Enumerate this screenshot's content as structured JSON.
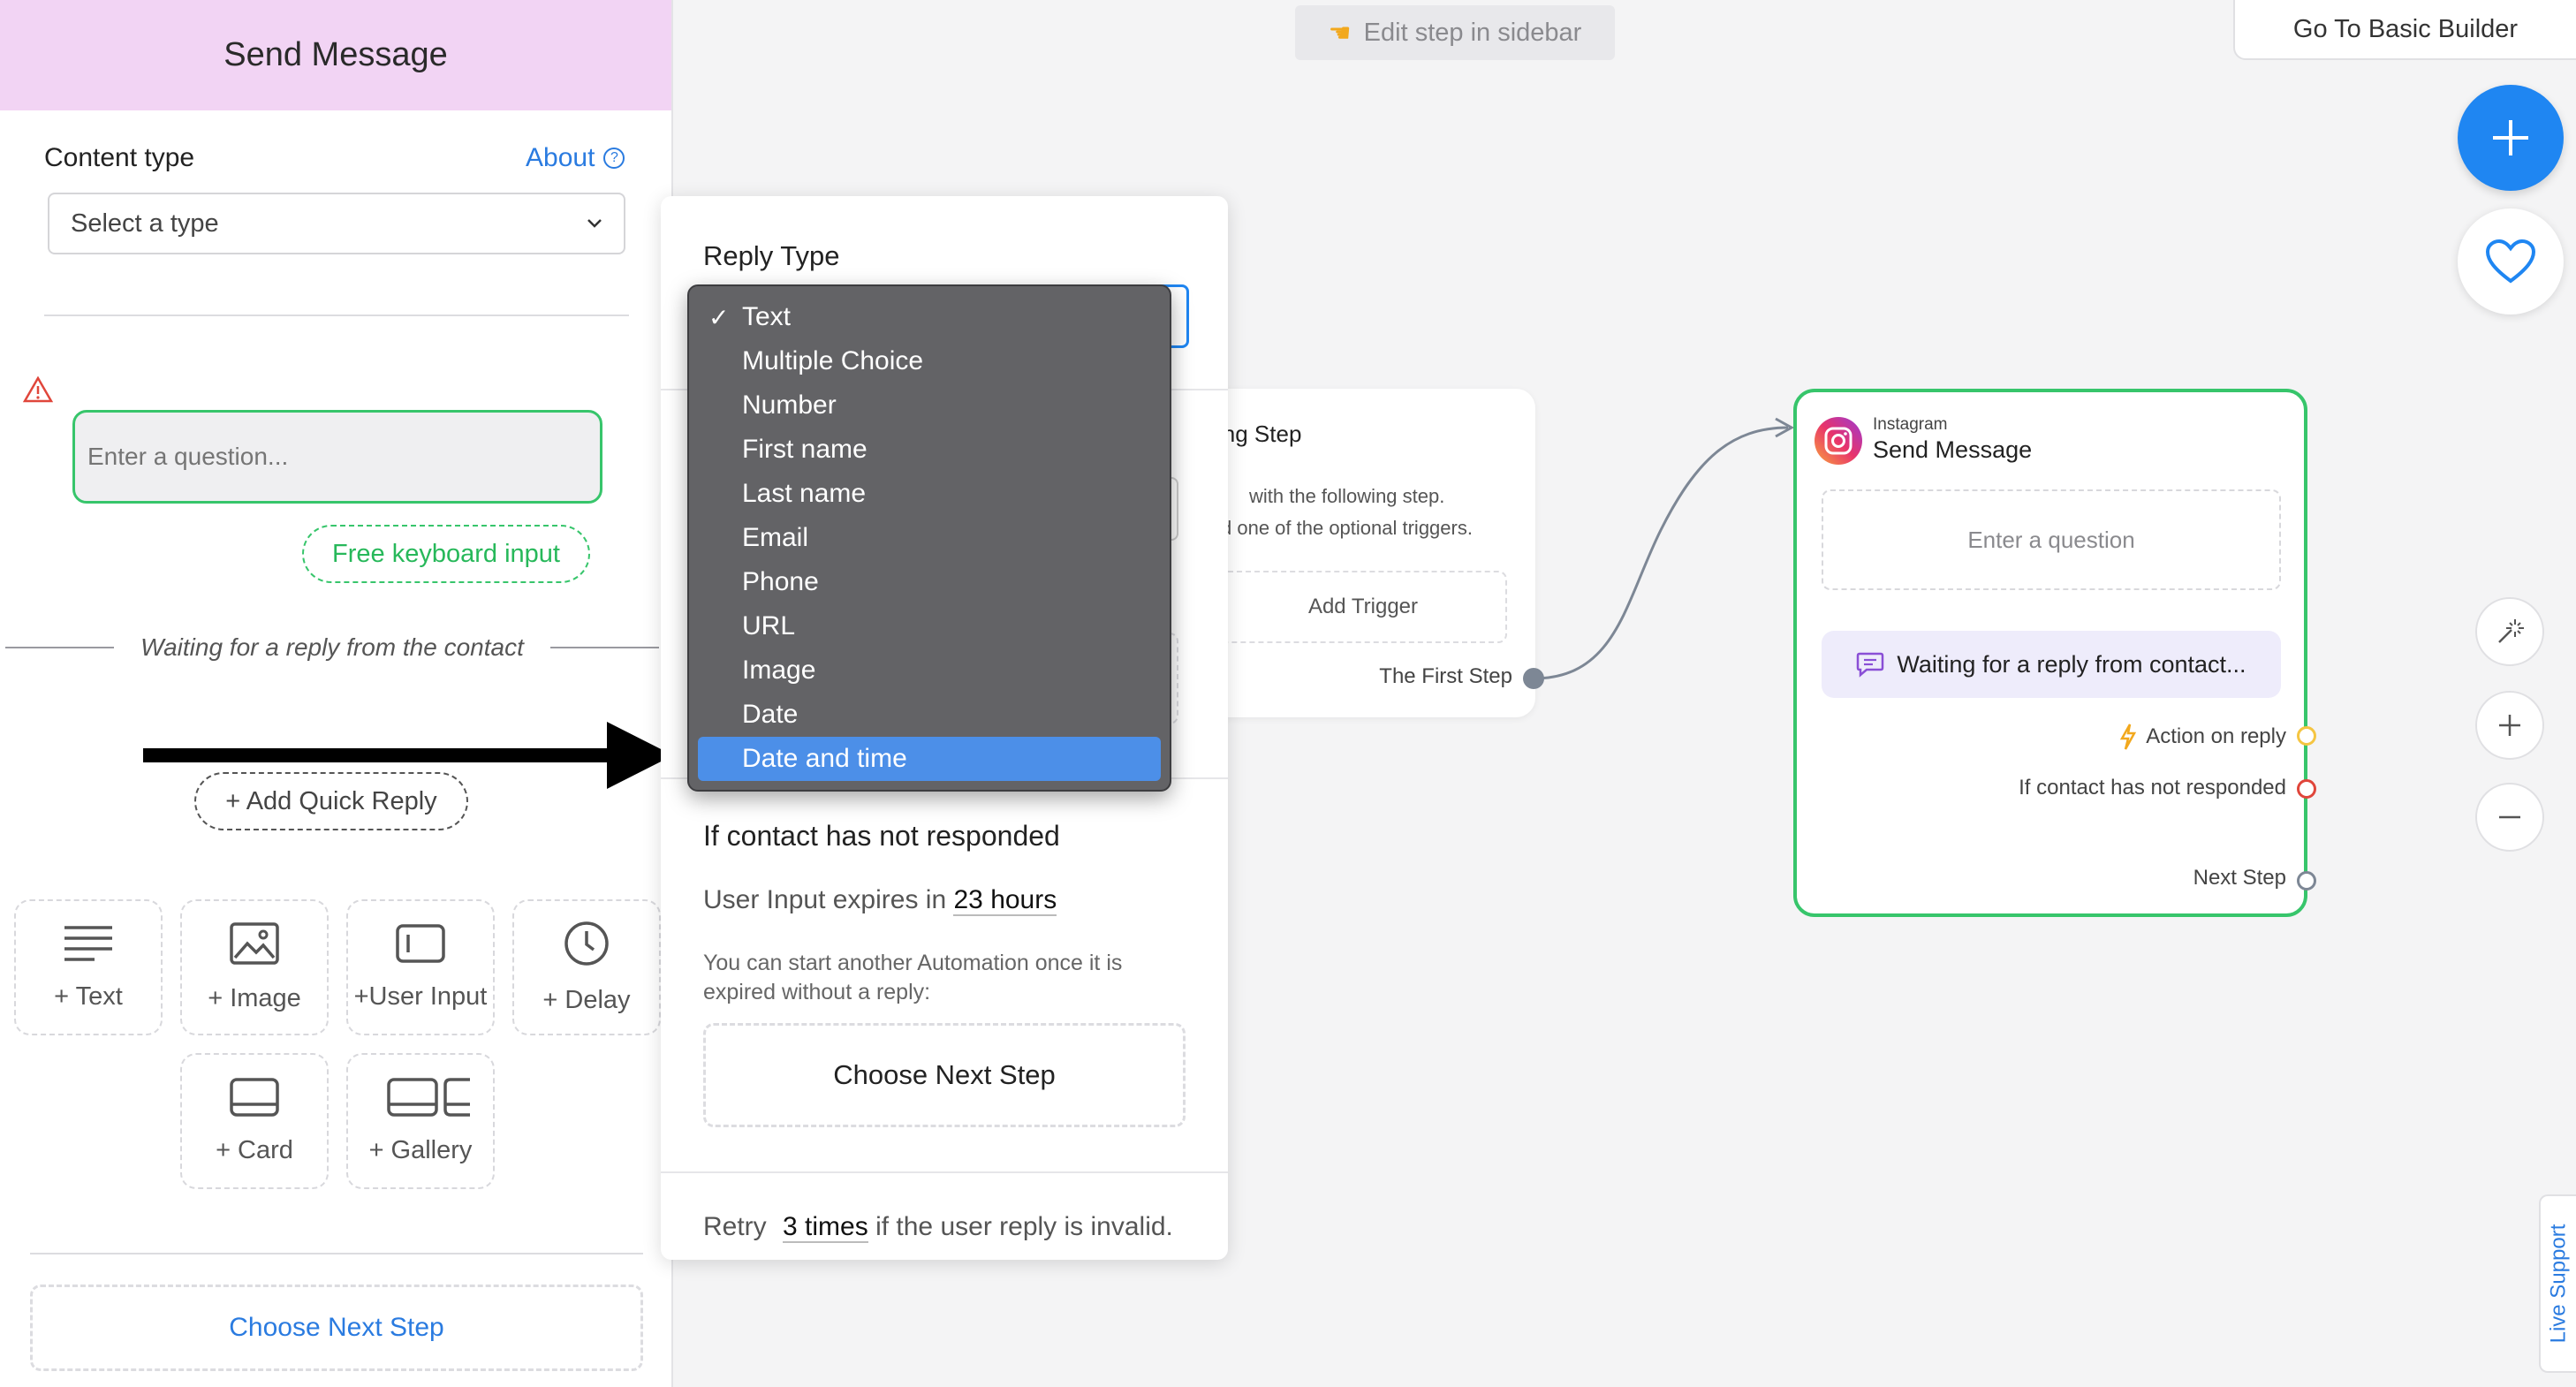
{
  "sidebar": {
    "title": "Send Message",
    "content_type_label": "Content type",
    "about_label": "About",
    "type_select_placeholder": "Select a type",
    "question_placeholder": "Enter a question...",
    "free_keyboard_label": "Free keyboard input",
    "waiting_text": "Waiting for a reply from the contact",
    "add_quick_reply_label": "+ Add Quick Reply",
    "tiles": [
      {
        "label": "+ Text",
        "icon": "text-lines-icon"
      },
      {
        "label": "+ Image",
        "icon": "image-icon"
      },
      {
        "label": "+User Input",
        "icon": "user-input-icon"
      },
      {
        "label": "+ Delay",
        "icon": "clock-icon"
      },
      {
        "label": "+ Card",
        "icon": "card-icon"
      },
      {
        "label": "+ Gallery",
        "icon": "gallery-icon"
      }
    ],
    "choose_next_step_label": "Choose Next Step"
  },
  "canvas": {
    "edit_hint": "Edit step in sidebar",
    "basic_builder_label": "Go To Basic Builder",
    "live_support_label": "Live Support",
    "start_node": {
      "title": "ing Step",
      "desc_line1": "with the following step.",
      "desc_line2": "d one of the optional triggers.",
      "add_trigger_label": "Add Trigger",
      "first_step_label": "The First Step"
    },
    "ig_node": {
      "channel": "Instagram",
      "title": "Send Message",
      "question_placeholder": "Enter a question",
      "waiting_label": "Waiting for a reply from contact...",
      "action_on_reply": "Action on reply",
      "not_responded": "If contact has not responded",
      "next_step": "Next Step"
    },
    "colors": {
      "accent": "#1f86f2",
      "success": "#37c56b",
      "warning": "#f5c542",
      "danger": "#e0463b"
    }
  },
  "panel": {
    "reply_type_label": "Reply Type",
    "not_responded_title": "If contact has not responded",
    "expires_prefix": "User Input expires in",
    "expires_value": "23 hours",
    "start_another_text": "You can start another Automation once it is expired without a reply:",
    "choose_next_step_label": "Choose Next Step",
    "retry_prefix": "Retry",
    "retry_value": "3 times",
    "retry_suffix": "if the user reply is invalid."
  },
  "dropdown": {
    "options": [
      "Text",
      "Multiple Choice",
      "Number",
      "First name",
      "Last name",
      "Email",
      "Phone",
      "URL",
      "Image",
      "Date",
      "Date and time"
    ],
    "checked": "Text",
    "highlighted": "Date and time"
  }
}
